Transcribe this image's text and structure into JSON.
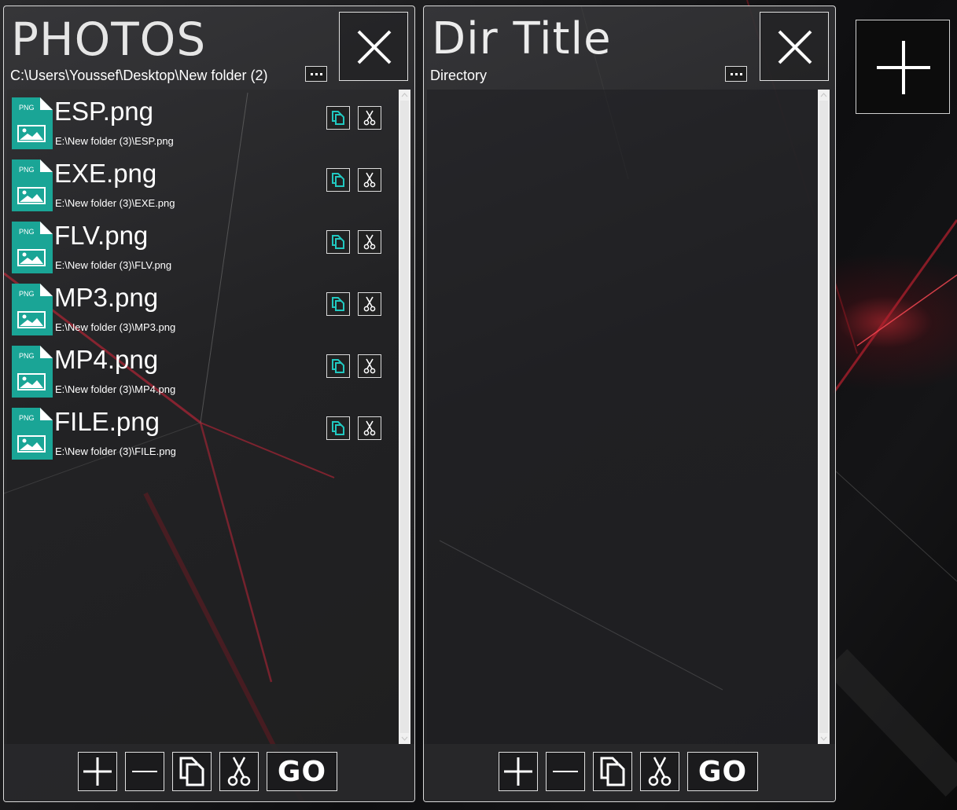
{
  "panels": [
    {
      "title": "PHOTOS",
      "path": "C:\\Users\\Youssef\\Desktop\\New folder (2)",
      "files": [
        {
          "name": "ESP.png",
          "path": "E:\\New folder (3)\\ESP.png",
          "icon_label": "PNG"
        },
        {
          "name": "EXE.png",
          "path": "E:\\New folder (3)\\EXE.png",
          "icon_label": "PNG"
        },
        {
          "name": "FLV.png",
          "path": "E:\\New folder (3)\\FLV.png",
          "icon_label": "PNG"
        },
        {
          "name": "MP3.png",
          "path": "E:\\New folder (3)\\MP3.png",
          "icon_label": "PNG"
        },
        {
          "name": "MP4.png",
          "path": "E:\\New folder (3)\\MP4.png",
          "icon_label": "PNG"
        },
        {
          "name": "FILE.png",
          "path": "E:\\New folder (3)\\FILE.png",
          "icon_label": "PNG"
        }
      ],
      "toolbar": {
        "go_label": "GO"
      }
    },
    {
      "title": "Dir Title",
      "path": "Directory",
      "files": [],
      "toolbar": {
        "go_label": "GO"
      }
    }
  ],
  "icons": {
    "close": "close-icon",
    "more": "ellipsis-icon",
    "copy": "copy-icon",
    "cut": "scissors-icon",
    "add": "plus-icon",
    "remove": "minus-icon",
    "file": "png-file-icon"
  },
  "colors": {
    "file_icon": "#1aa596",
    "copy_icon_accent": "#21c8c0",
    "accent_red": "#c8283a"
  }
}
